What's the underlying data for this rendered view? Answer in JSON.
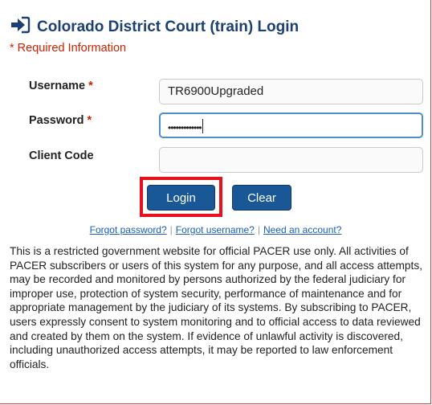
{
  "header": {
    "title": "Colorado District Court (train) Login",
    "required_note": "* Required Information",
    "icon": "sign-in-arrow-icon"
  },
  "form": {
    "username": {
      "label": "Username",
      "required_mark": "*",
      "value": "TR6900Upgraded"
    },
    "password": {
      "label": "Password",
      "required_mark": "*",
      "value": "•••••••••••••"
    },
    "client_code": {
      "label": "Client Code",
      "value": ""
    }
  },
  "buttons": {
    "login": "Login",
    "clear": "Clear"
  },
  "links": {
    "forgot_password": "Forgot password?",
    "separator": "|",
    "forgot_username": "Forgot username?",
    "need_account": "Need an account?"
  },
  "notice": "This is a restricted government website for official PACER use only. All activities of PACER subscribers or users of this system for any purpose, and all access attempts, may be recorded and monitored by persons authorized by the federal judiciary for improper use, protection of system security, performance of maintenance and for appropriate management by the judiciary of its systems. By subscribing to PACER, users expressly consent to system monitoring and to official access to data reviewed and created by them on the system. If evidence of unlawful activity is discovered, including unauthorized access attempts, it may be reported to law enforcement officials.",
  "colors": {
    "title": "#1c3f74",
    "required": "#cc2200",
    "button": "#1a5797",
    "link": "#1a5dbb",
    "highlight": "#e8101c",
    "focus_border": "#4f8ecb"
  }
}
